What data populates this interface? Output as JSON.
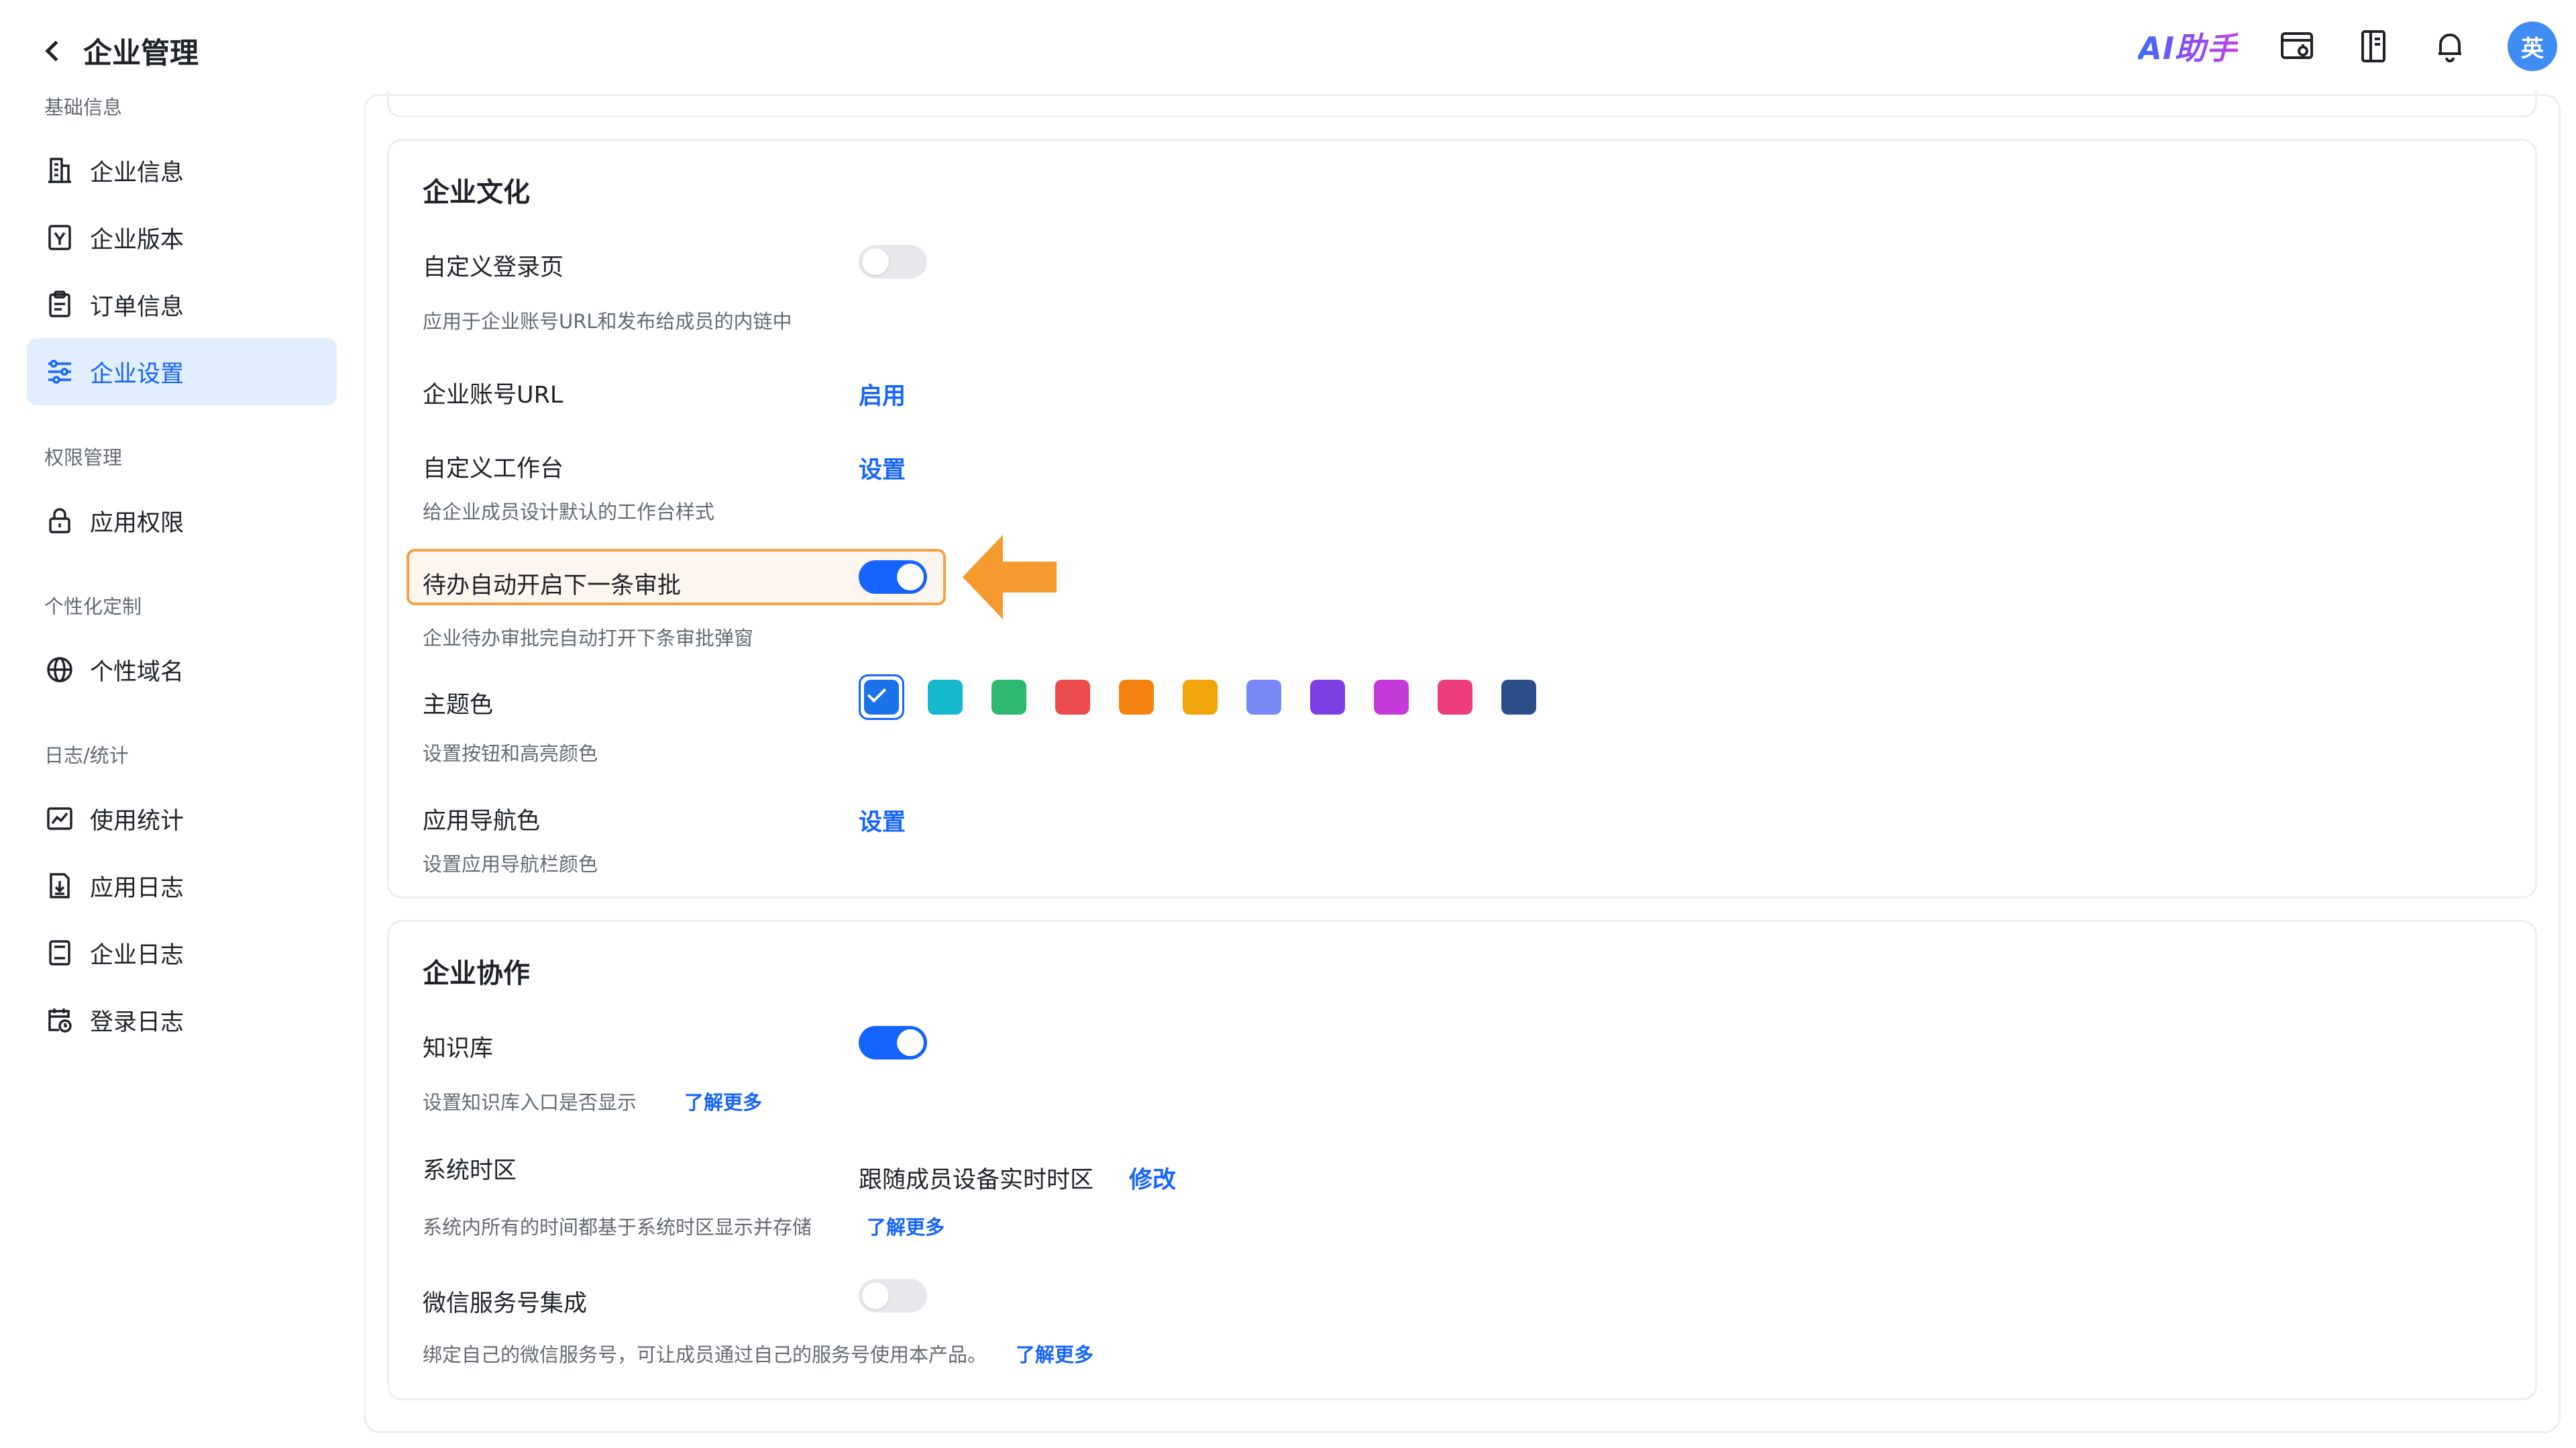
{
  "header": {
    "title": "企业管理"
  },
  "topbar": {
    "ai_label": "AI助手",
    "avatar_text": "英"
  },
  "sidebar": {
    "groups": [
      {
        "label": "基础信息",
        "items": [
          "企业信息",
          "企业版本",
          "订单信息",
          "企业设置"
        ]
      },
      {
        "label": "权限管理",
        "items": [
          "应用权限"
        ]
      },
      {
        "label": "个性化定制",
        "items": [
          "个性域名"
        ]
      },
      {
        "label": "日志/统计",
        "items": [
          "使用统计",
          "应用日志",
          "企业日志",
          "登录日志"
        ]
      }
    ],
    "active_item": "企业设置"
  },
  "culture": {
    "title": "企业文化",
    "custom_login": {
      "label": "自定义登录页",
      "desc": "应用于企业账号URL和发布给成员的内链中",
      "enabled": false
    },
    "account_url": {
      "label": "企业账号URL",
      "action": "启用"
    },
    "workbench": {
      "label": "自定义工作台",
      "action": "设置",
      "desc": "给企业成员设计默认的工作台样式"
    },
    "auto_next": {
      "label": "待办自动开启下一条审批",
      "desc": "企业待办审批完自动打开下条审批弹窗",
      "enabled": true
    },
    "theme": {
      "label": "主题色",
      "desc": "设置按钮和高亮颜色",
      "colors": [
        "#1a73e8",
        "#15b8cc",
        "#2eb872",
        "#eb4b4b",
        "#f5820f",
        "#f0a50a",
        "#7a88f5",
        "#7b3fe4",
        "#c43ad8",
        "#ee3d7f",
        "#2c4f8a"
      ],
      "selected_index": 0
    },
    "nav_color": {
      "label": "应用导航色",
      "action": "设置",
      "desc": "设置应用导航栏颜色"
    }
  },
  "collab": {
    "title": "企业协作",
    "kb": {
      "label": "知识库",
      "desc": "设置知识库入口是否显示",
      "link": "了解更多",
      "enabled": true
    },
    "timezone": {
      "label": "系统时区",
      "value": "跟随成员设备实时时区",
      "action": "修改",
      "desc": "系统内所有的时间都基于系统时区显示并存储",
      "link": "了解更多"
    },
    "wechat": {
      "label": "微信服务号集成",
      "desc": "绑定自己的微信服务号，可让成员通过自己的服务号使用本产品。",
      "link": "了解更多",
      "enabled": false
    }
  }
}
